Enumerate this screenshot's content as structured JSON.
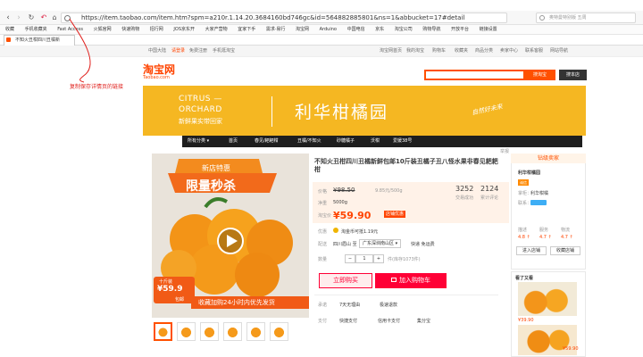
{
  "browser": {
    "url": "https://item.taobao.com/item.htm?spm=a210r.1.14.20.3684160bd746gc&id=564882885801&ns=1&abbucket=17#detail",
    "search_placeholder": "奥特曼特别版 五周",
    "tab_title": "不知火丑柑四川丑橘新",
    "bookmarks": [
      "收藏",
      "手机收藏夹",
      "Fast Access",
      "火狐官网",
      "快速购物",
      "招行网",
      "JOS京东开",
      "大家产营物",
      "宜家下手",
      "需求·易行",
      "淘宝网",
      "Arduino",
      "中国电信",
      "京东",
      "淘宝公司",
      "购物导航",
      "开放平台",
      "链接设置"
    ]
  },
  "topbar": {
    "links": [
      "中国大陆",
      "请登录",
      "免费注册",
      "手机逛淘宝",
      "淘宝网首页",
      "我的淘宝",
      "购物车",
      "收藏夹",
      "商品分类",
      "卖家中心",
      "联系客服",
      "网站导航"
    ]
  },
  "header": {
    "logo_cn": "淘宝网",
    "logo_en": "Taobao.com",
    "search_button": "搜淘宝",
    "search_store_button": "搜本店"
  },
  "annotation": {
    "text": "复制保存详情页的链接",
    "color": "#e0201c"
  },
  "banner": {
    "en_line1": "CITRUS —",
    "en_line2": "ORCHARD",
    "cn_subtitle": "新鲜果实带回家",
    "title": "利华柑橘园",
    "signature": "自然好未来",
    "color": "#f5b722"
  },
  "store_nav": {
    "items": [
      "所有分类 ▾",
      "首页",
      "春见/耙耙柑",
      "丑橘/不知火",
      "砂糖橘子",
      "沃柑",
      "爱媛38号"
    ]
  },
  "breadcrumb": "举报",
  "gallery": {
    "promo_top": "新店特惠",
    "promo_big": "限量秒杀",
    "weight_label": "十斤装",
    "price": "¥59.9",
    "shipping": "包邮",
    "ribbon": "收藏加购24小时内优先发货"
  },
  "product": {
    "title": "不知火丑柑四川丑橘新鲜包邮10斤装丑橘子丑八怪水果非春见耙耙柑",
    "price_label": "价格",
    "orig_price": "¥98.50",
    "unit_price": "9.85元/500g",
    "weight_label": "净重",
    "weight_value": "5000g",
    "promo_label": "淘宝价",
    "promo_price": "¥59.90",
    "promo_badge": "店铺优惠",
    "monthly_sales_num": "3252",
    "monthly_sales_label": "交易成功",
    "reviews_num": "2124",
    "reviews_label": "累计评论",
    "benefit_label": "优惠",
    "benefit_value": "淘金币可抵1.19元",
    "ship_label": "配送",
    "ship_from": "四川眉山 至",
    "ship_to": "广东深圳南山区 ▾",
    "ship_fee": "快递 免运费",
    "qty_label": "数量",
    "qty_value": "1",
    "stock": "件(库存1073件)",
    "buy_now": "立即购买",
    "add_cart": "加入购物车",
    "promise_label": "承诺",
    "promise_1": "7天无理由",
    "promise_2": "极速退款",
    "pay_label": "支付",
    "pay_1": "快捷支付",
    "pay_2": "信用卡支付",
    "pay_3": "集分宝"
  },
  "shop": {
    "header": "钻级卖家",
    "name": "利华柑橘园",
    "tag": "诚信",
    "seller_label": "掌柜：",
    "seller_value": "利华柑橘",
    "contact_label": "联系：",
    "rating_labels": [
      "描述",
      "服务",
      "物流"
    ],
    "rating_values": [
      "4.8 ↑",
      "4.7 ↑",
      "4.7 ↑"
    ],
    "enter_button": "进入店铺",
    "fav_button": "收藏店铺"
  },
  "recommend": {
    "header": "看了又看",
    "price_1": "¥39.90",
    "price_2": "¥59.90"
  }
}
